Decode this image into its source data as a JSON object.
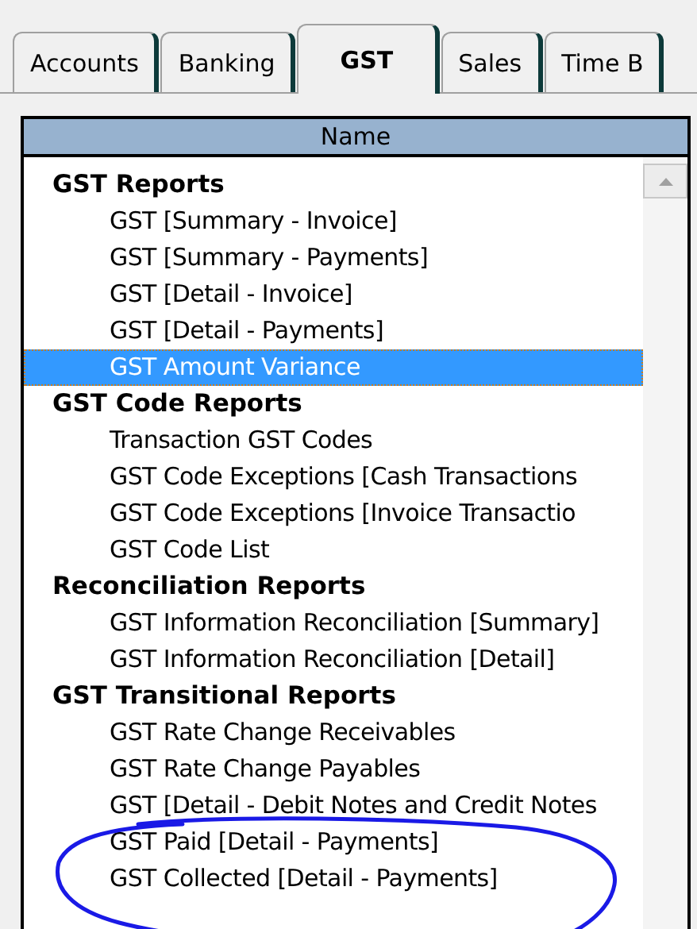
{
  "tabs": [
    {
      "label": "Accounts",
      "selected": false
    },
    {
      "label": "Banking",
      "selected": false
    },
    {
      "label": "GST",
      "selected": true
    },
    {
      "label": "Sales",
      "selected": false
    },
    {
      "label": "Time B",
      "selected": false
    }
  ],
  "list": {
    "column": "Name",
    "groups": [
      {
        "title": "GST Reports",
        "children": [
          {
            "label": "GST [Summary - Invoice]",
            "selected": false
          },
          {
            "label": "GST [Summary - Payments]",
            "selected": false
          },
          {
            "label": "GST [Detail - Invoice]",
            "selected": false
          },
          {
            "label": "GST [Detail - Payments]",
            "selected": false
          },
          {
            "label": "GST Amount Variance",
            "selected": true
          }
        ]
      },
      {
        "title": "GST Code Reports",
        "children": [
          {
            "label": "Transaction GST Codes",
            "selected": false
          },
          {
            "label": "GST Code Exceptions [Cash Transactions",
            "selected": false
          },
          {
            "label": "GST Code Exceptions [Invoice Transactio",
            "selected": false
          },
          {
            "label": "GST Code List",
            "selected": false
          }
        ]
      },
      {
        "title": "Reconciliation Reports",
        "children": [
          {
            "label": "GST Information Reconciliation [Summary]",
            "selected": false
          },
          {
            "label": "GST Information Reconciliation [Detail]",
            "selected": false
          }
        ]
      },
      {
        "title": "GST Transitional Reports",
        "children": [
          {
            "label": "GST Rate Change Receivables",
            "selected": false
          },
          {
            "label": "GST Rate Change Payables",
            "selected": false
          },
          {
            "label": "GST [Detail - Debit Notes and Credit Notes",
            "selected": false
          },
          {
            "label": "GST Paid [Detail - Payments]",
            "selected": false
          },
          {
            "label": "GST Collected [Detail - Payments]",
            "selected": false
          }
        ]
      }
    ]
  }
}
